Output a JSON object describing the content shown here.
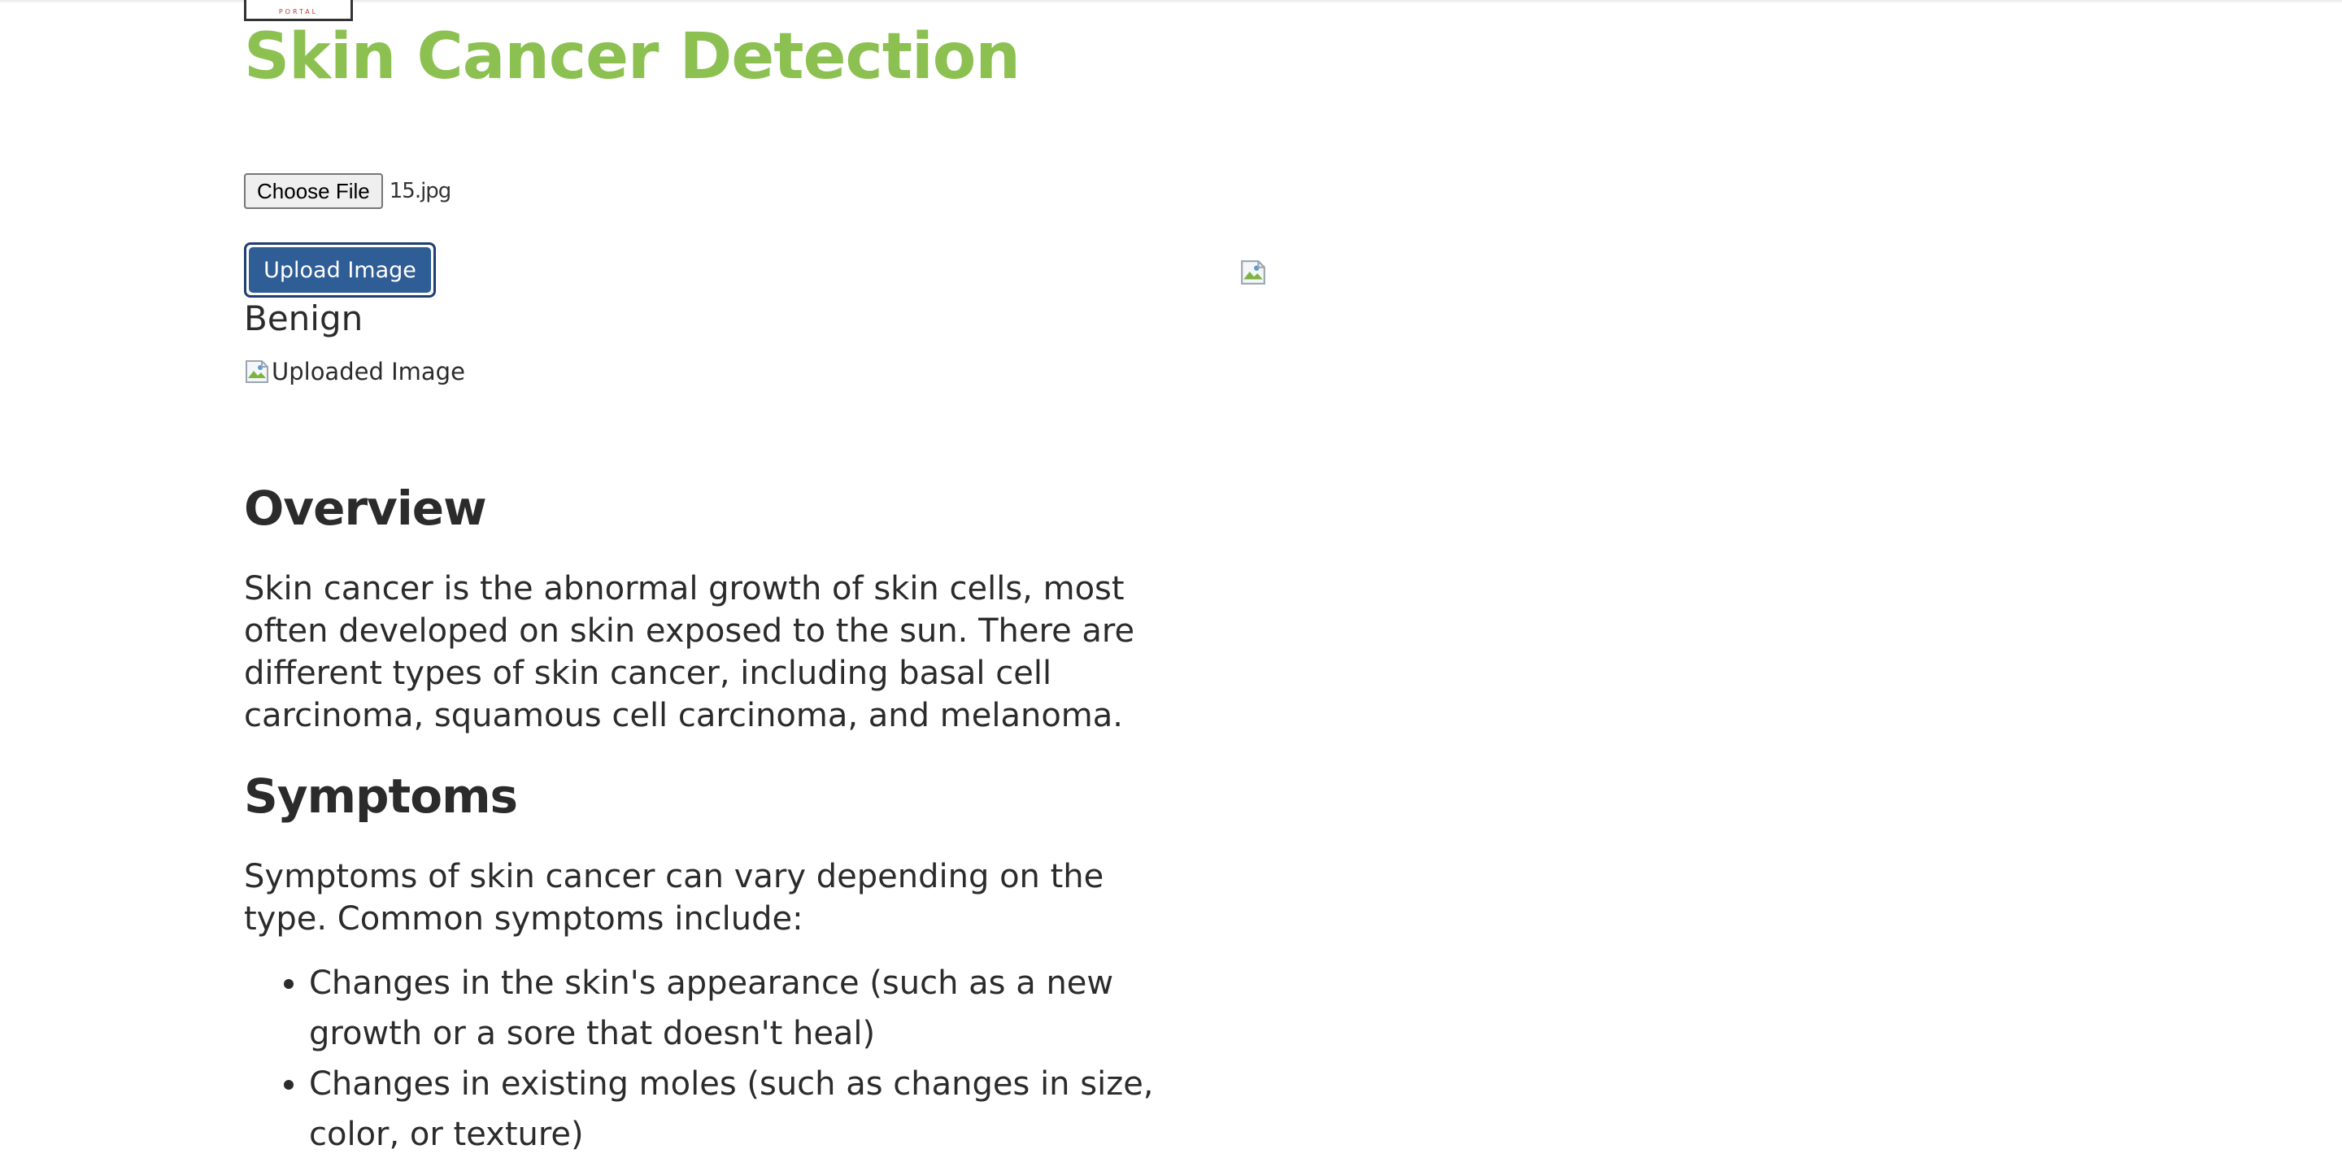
{
  "header": {
    "logo_text": "PORTAL",
    "title": "Skin Cancer Detection"
  },
  "upload": {
    "choose_file_label": "Choose File",
    "file_name": "15.jpg",
    "upload_button_label": "Upload Image",
    "result": "Benign",
    "uploaded_image_alt": "Uploaded Image"
  },
  "overview": {
    "heading": "Overview",
    "text": "Skin cancer is the abnormal growth of skin cells, most often developed on skin exposed to the sun. There are different types of skin cancer, including basal cell carcinoma, squamous cell carcinoma, and melanoma."
  },
  "symptoms": {
    "heading": "Symptoms",
    "intro": "Symptoms of skin cancer can vary depending on the type. Common symptoms include:",
    "items": [
      "Changes in the skin's appearance (such as a new growth or a sore that doesn't heal)",
      "Changes in existing moles (such as changes in size, color, or texture)"
    ]
  },
  "colors": {
    "title": "#8cc152",
    "button": "#2f5d95",
    "text": "#2b2b2b"
  }
}
